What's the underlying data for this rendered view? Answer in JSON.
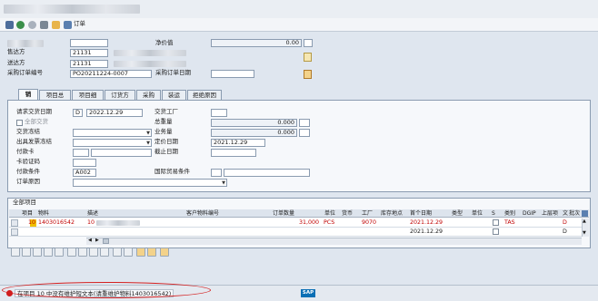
{
  "toolbar": {
    "order_label": "订单",
    "sap_logo": "SAP"
  },
  "header": {
    "net_value_label": "净价值",
    "net_value": "0.00",
    "sold_to_label": "售达方",
    "sold_to_value": "21131",
    "ship_to_label": "送达方",
    "ship_to_value": "21131",
    "po_number_label": "采购订单编号",
    "po_number_value": "PO20211224-0007",
    "po_date_label": "采购订单日期"
  },
  "tabs": [
    "销售",
    "项目总览",
    "项目细节",
    "订货方",
    "采购",
    "装运",
    "拒绝原因"
  ],
  "form": {
    "req_date_label": "请求交货日期",
    "req_date_type": "D",
    "req_date": "2022.12.29",
    "deliv_plant_label": "交货工厂",
    "complete_deliv_label": "全部交货",
    "total_weight_label": "总重量",
    "total_weight": "0.000",
    "deliv_block_label": "交货冻结",
    "volume_label": "业务量",
    "volume": "0.000",
    "billing_block_label": "出具发票冻结",
    "pricing_date_label": "定价日期",
    "pricing_date": "2021.12.29",
    "payment_card_label": "付款卡",
    "expiry_label": "截止日期",
    "card_verif_label": "卡验证码",
    "payment_terms_label": "付款条件",
    "payment_terms": "A002",
    "incoterms_label": "国际贸易条件",
    "order_reason_label": "订单原因"
  },
  "items": {
    "section_title": "全部项目",
    "columns": [
      "项目",
      "物料",
      "描述",
      "客户物料编号",
      "订单数量",
      "单位",
      "货币",
      "工厂",
      "库存地点",
      "首个日期",
      "类型",
      "单位",
      "S",
      "类别",
      "DGIP",
      "上层项",
      "文",
      "批次"
    ],
    "rows": [
      {
        "item": "10",
        "material": "1403016542",
        "desc": "10",
        "qty": "31,000",
        "unit": "PCS",
        "plant": "9070",
        "first_date": "2021.12.29",
        "category": "TAS",
        "d": "D"
      },
      {
        "item": "",
        "material": "",
        "desc": "",
        "qty": "",
        "unit": "",
        "plant": "",
        "first_date": "2021.12.29",
        "category": "",
        "d": "D"
      }
    ]
  },
  "status": {
    "message": "在项目 10 中没有维护短文本(请重维护物料1403016542)"
  },
  "colors": {
    "accent": "#c00000",
    "frame": "#8a9bb0",
    "tab_bg": "#e9eef4"
  }
}
